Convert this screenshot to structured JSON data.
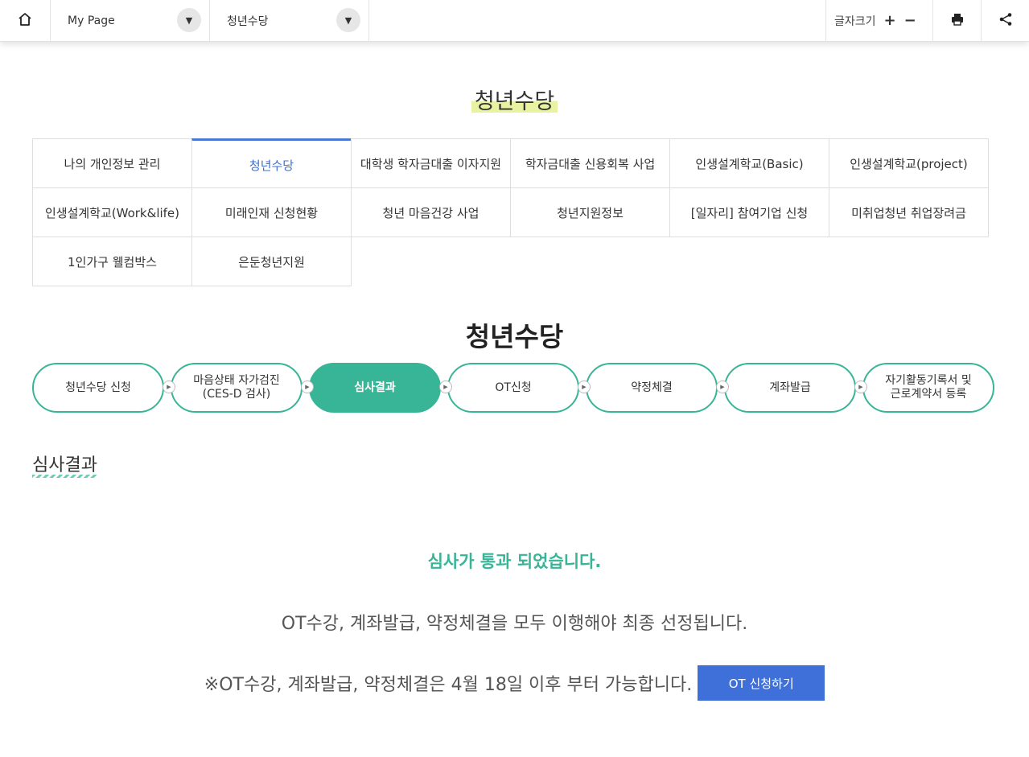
{
  "topbar": {
    "breadcrumb1": "My Page",
    "breadcrumb2": "청년수당",
    "font_size_label": "글자크기",
    "font_plus": "+",
    "font_minus": "−"
  },
  "page_title": "청년수당",
  "menu": [
    {
      "label": "나의 개인정보 관리",
      "active": false
    },
    {
      "label": "청년수당",
      "active": true
    },
    {
      "label": "대학생 학자금대출 이자지원",
      "active": false
    },
    {
      "label": "학자금대출 신용회복 사업",
      "active": false
    },
    {
      "label": "인생설계학교(Basic)",
      "active": false
    },
    {
      "label": "인생설계학교(project)",
      "active": false
    },
    {
      "label": "인생설계학교(Work&life)",
      "active": false
    },
    {
      "label": "미래인재 신청현황",
      "active": false
    },
    {
      "label": "청년 마음건강 사업",
      "active": false
    },
    {
      "label": "청년지원정보",
      "active": false
    },
    {
      "label": "[일자리] 참여기업 신청",
      "active": false
    },
    {
      "label": "미취업청년 취업장려금",
      "active": false
    },
    {
      "label": "1인가구 웰컴박스",
      "active": false
    },
    {
      "label": "은둔청년지원",
      "active": false
    }
  ],
  "section_title": "청년수당",
  "steps": [
    {
      "line1": "청년수당 신청",
      "line2": "",
      "active": false
    },
    {
      "line1": "마음상태 자가검진",
      "line2": "(CES-D 검사)",
      "active": false
    },
    {
      "line1": "심사결과",
      "line2": "",
      "active": true
    },
    {
      "line1": "OT신청",
      "line2": "",
      "active": false
    },
    {
      "line1": "약정체결",
      "line2": "",
      "active": false
    },
    {
      "line1": "계좌발급",
      "line2": "",
      "active": false
    },
    {
      "line1": "자기활동기록서 및",
      "line2": "근로계약서 등록",
      "active": false
    }
  ],
  "result": {
    "label": "심사결과",
    "pass_message": "심사가 통과 되었습니다.",
    "info": "OT수강, 계좌발급, 약정체결을 모두 이행해야 최종 선정됩니다.",
    "note": "※OT수강, 계좌발급, 약정체결은 4월 18일 이후 부터 가능합니다.",
    "ot_button": "OT 신청하기"
  },
  "colors": {
    "accent_green": "#38b497",
    "accent_blue": "#3f6fd8",
    "highlight": "#e8f2a0"
  },
  "icons": [
    "home-icon",
    "chevron-down-icon",
    "print-icon",
    "share-icon",
    "play-arrow-icon"
  ]
}
